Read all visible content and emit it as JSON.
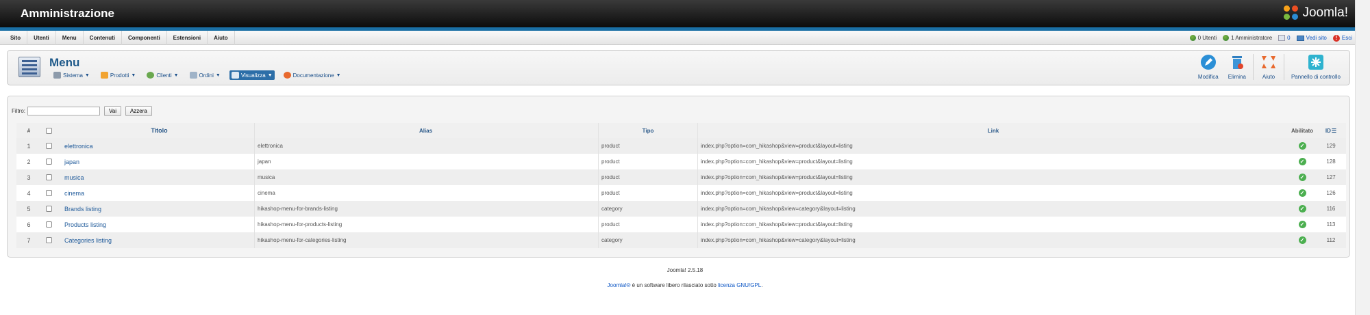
{
  "header": {
    "title": "Amministrazione",
    "logo_text": "Joomla!"
  },
  "menubar": {
    "items": [
      "Sito",
      "Utenti",
      "Menu",
      "Contenuti",
      "Componenti",
      "Estensioni",
      "Aiuto"
    ],
    "status": {
      "users": "0 Utenti",
      "admins": "1 Amministratore",
      "messages": "0",
      "view_site": "Vedi sito",
      "logout": "Esci"
    }
  },
  "toolbar": {
    "page_title": "Menu",
    "hikashop_menu": [
      "Sistema",
      "Prodotti",
      "Clienti",
      "Ordini",
      "Visualizza",
      "Documentazione"
    ],
    "actions": [
      "Modifica",
      "Elimina",
      "Aiuto",
      "Pannello di controllo"
    ]
  },
  "filter": {
    "label": "Filtro:",
    "value": "",
    "go_label": "Vai",
    "reset_label": "Azzera"
  },
  "table": {
    "headers": {
      "num": "#",
      "title": "Titolo",
      "alias": "Alias",
      "type": "Tipo",
      "link": "Link",
      "enabled": "Abilitato",
      "id": "ID"
    },
    "rows": [
      {
        "num": "1",
        "title": "elettronica",
        "alias": "elettronica",
        "type": "product",
        "link": "index.php?option=com_hikashop&view=product&layout=listing",
        "id": "129"
      },
      {
        "num": "2",
        "title": "japan",
        "alias": "japan",
        "type": "product",
        "link": "index.php?option=com_hikashop&view=product&layout=listing",
        "id": "128"
      },
      {
        "num": "3",
        "title": "musica",
        "alias": "musica",
        "type": "product",
        "link": "index.php?option=com_hikashop&view=product&layout=listing",
        "id": "127"
      },
      {
        "num": "4",
        "title": "cinema",
        "alias": "cinema",
        "type": "product",
        "link": "index.php?option=com_hikashop&view=product&layout=listing",
        "id": "126"
      },
      {
        "num": "5",
        "title": "Brands listing",
        "alias": "hikashop-menu-for-brands-listing",
        "type": "category",
        "link": "index.php?option=com_hikashop&view=category&layout=listing",
        "id": "116"
      },
      {
        "num": "6",
        "title": "Products listing",
        "alias": "hikashop-menu-for-products-listing",
        "type": "product",
        "link": "index.php?option=com_hikashop&view=product&layout=listing",
        "id": "113"
      },
      {
        "num": "7",
        "title": "Categories listing",
        "alias": "hikashop-menu-for-categories-listing",
        "type": "category",
        "link": "index.php?option=com_hikashop&view=category&layout=listing",
        "id": "112"
      }
    ]
  },
  "footer": {
    "version": "Joomla! 2.5.18",
    "license_link": "Joomla!®",
    "license_text": " è un software libero rilasciato sotto ",
    "license_name": "licenza GNU/GPL",
    "license_end": "."
  },
  "colors": {
    "header_dark": "#0c0c0c",
    "accent_blue": "#1a6fa5",
    "link_blue": "#1f5a9a",
    "ok_green": "#4caf50"
  }
}
